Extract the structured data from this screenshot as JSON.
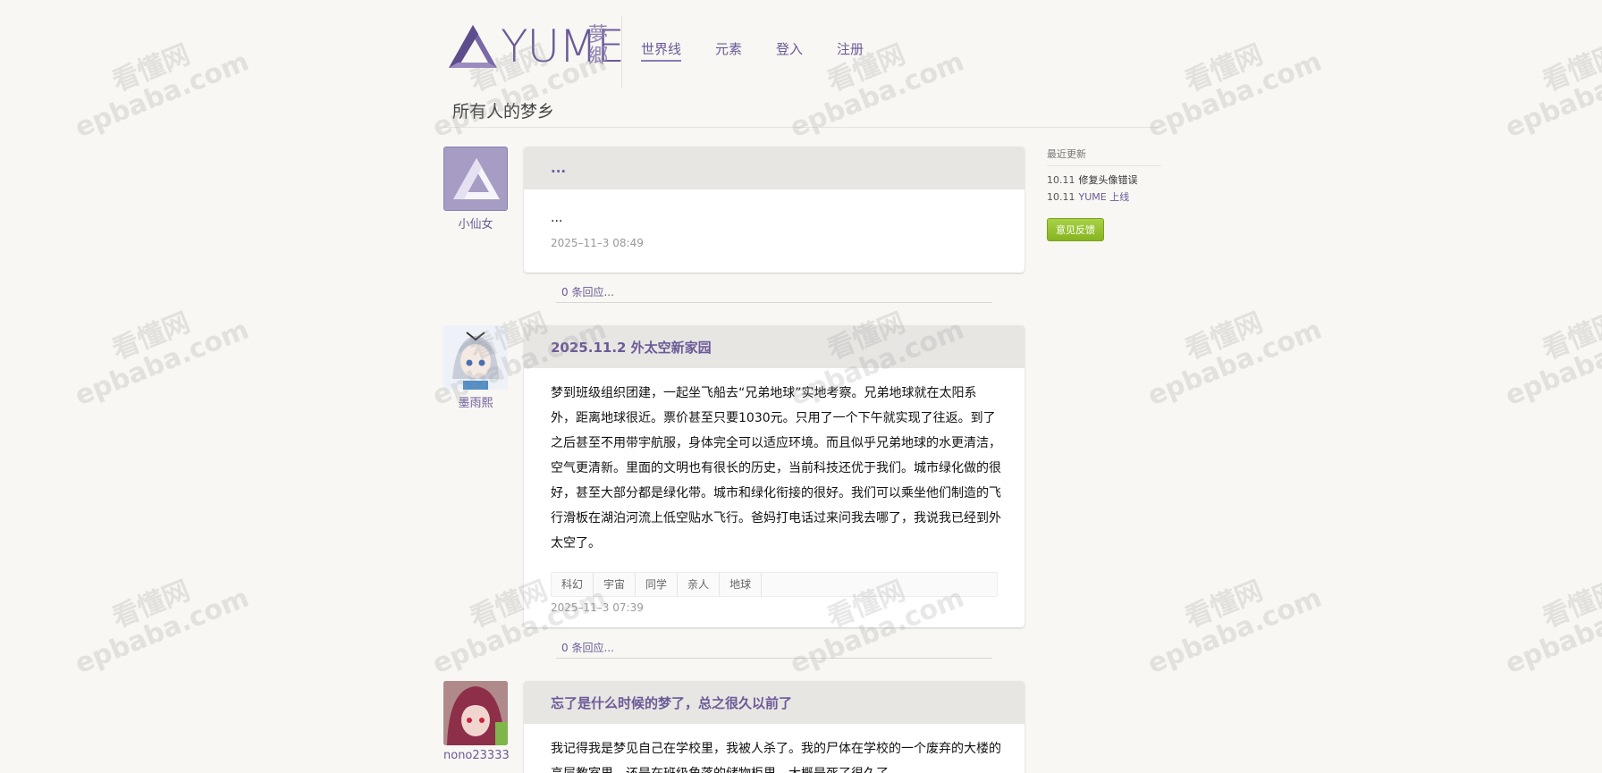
{
  "brand": {
    "name": "YUME",
    "sub": "夢郷"
  },
  "nav": [
    {
      "label": "世界线",
      "active": true
    },
    {
      "label": "元素",
      "active": false
    },
    {
      "label": "登入",
      "active": false
    },
    {
      "label": "注册",
      "active": false
    }
  ],
  "page_title": "所有人的梦乡",
  "sidebar": {
    "heading": "最近更新",
    "updates": [
      {
        "date": "10.11",
        "text": "修复头像错误",
        "is_link": false
      },
      {
        "date": "10.11",
        "text": "YUME 上线",
        "is_link": true
      }
    ],
    "feedback_label": "意见反馈"
  },
  "posts": [
    {
      "author": "小仙女",
      "title": "...",
      "body": "...",
      "time": "2025–11–3 08:49",
      "tags": [],
      "replies": "0 条回应..."
    },
    {
      "author": "墨雨熙",
      "title": "2025.11.2 外太空新家园",
      "body": "梦到班级组织团建，一起坐飞船去“兄弟地球”实地考察。兄弟地球就在太阳系外，距离地球很近。票价甚至只要1030元。只用了一个下午就实现了往返。到了之后甚至不用带宇航服，身体完全可以适应环境。而且似乎兄弟地球的水更清洁，空气更清新。里面的文明也有很长的历史，当前科技还优于我们。城市绿化做的很好，甚至大部分都是绿化带。城市和绿化衔接的很好。我们可以乘坐他们制造的飞行滑板在湖泊河流上低空贴水飞行。爸妈打电话过来问我去哪了，我说我已经到外太空了。",
      "time": "2025–11–3 07:39",
      "tags": [
        "科幻",
        "宇宙",
        "同学",
        "亲人",
        "地球"
      ],
      "replies": "0 条回应..."
    },
    {
      "author": "nono23333",
      "title": "忘了是什么时候的梦了，总之很久以前了",
      "body": "我记得我是梦见自己在学校里，我被人杀了。我的尸体在学校的一个废弃的大楼的高层教室里，还是在班级角落的储物柜里。大概是死了很久了……",
      "time": "",
      "tags": [],
      "replies": ""
    }
  ],
  "watermark": {
    "line1": "看懂网",
    "line2": "epbaba.com"
  },
  "colors": {
    "accent": "#6b5a98",
    "card_head": "#e8e6e3",
    "feedback": "#96c232"
  }
}
